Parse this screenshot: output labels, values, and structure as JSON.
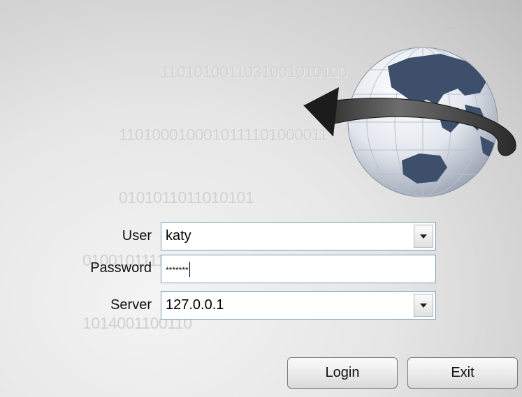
{
  "background": {
    "binary_lines": [
      "1101010011031001010100",
      "1101000100010111101000011",
      "0101011011010101",
      "01001011110000111031000",
      "1014001100110"
    ]
  },
  "window_controls": {
    "minimize": "minimize-icon",
    "close": "close-icon"
  },
  "form": {
    "user_label": "User",
    "user_value": "katy",
    "password_label": "Password",
    "password_value": "*******",
    "server_label": "Server",
    "server_value": "127.0.0.1"
  },
  "buttons": {
    "login": "Login",
    "exit": "Exit"
  },
  "colors": {
    "field_border": "#7f9db9",
    "globe_ocean": "#e8ecf2",
    "globe_land": "#3d4f6b"
  }
}
